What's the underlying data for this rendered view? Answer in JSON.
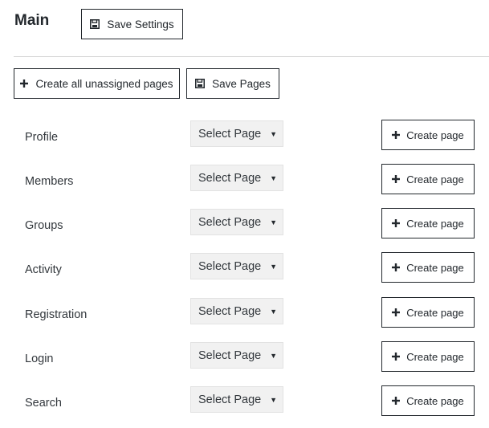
{
  "header": {
    "title": "Main",
    "save_settings_label": "Save Settings"
  },
  "toolbar": {
    "create_all_label": "Create all unassigned pages",
    "save_pages_label": "Save Pages"
  },
  "icons": {
    "save": "floppy-disk-icon",
    "plus": "plus-icon"
  },
  "rows": [
    {
      "label": "Profile",
      "select_value": "Select Page",
      "create_label": "Create page"
    },
    {
      "label": "Members",
      "select_value": "Select Page",
      "create_label": "Create page"
    },
    {
      "label": "Groups",
      "select_value": "Select Page",
      "create_label": "Create page"
    },
    {
      "label": "Activity",
      "select_value": "Select Page",
      "create_label": "Create page"
    },
    {
      "label": "Registration",
      "select_value": "Select Page",
      "create_label": "Create page"
    },
    {
      "label": "Login",
      "select_value": "Select Page",
      "create_label": "Create page"
    },
    {
      "label": "Search",
      "select_value": "Select Page",
      "create_label": "Create page"
    }
  ]
}
